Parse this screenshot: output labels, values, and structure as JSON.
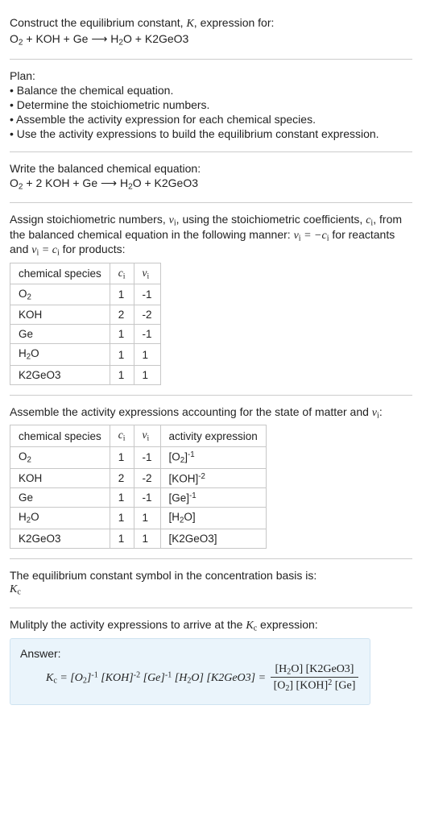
{
  "intro": {
    "line1_a": "Construct the equilibrium constant, ",
    "line1_b": ", expression for:",
    "equation": "O₂ + KOH + Ge ⟶ H₂O + K2GeO3"
  },
  "plan": {
    "heading": "Plan:",
    "items": [
      "• Balance the chemical equation.",
      "• Determine the stoichiometric numbers.",
      "• Assemble the activity expression for each chemical species.",
      "• Use the activity expressions to build the equilibrium constant expression."
    ]
  },
  "balanced": {
    "heading": "Write the balanced chemical equation:",
    "equation": "O₂ + 2 KOH + Ge ⟶ H₂O + K2GeO3"
  },
  "assign": {
    "text_a": "Assign stoichiometric numbers, ",
    "text_b": ", using the stoichiometric coefficients, ",
    "text_c": ", from the balanced chemical equation in the following manner: ",
    "text_d": " for reactants and ",
    "text_e": " for products:",
    "headers": [
      "chemical species",
      "cᵢ",
      "νᵢ"
    ],
    "rows": [
      {
        "species": "O₂",
        "c": "1",
        "v": "-1"
      },
      {
        "species": "KOH",
        "c": "2",
        "v": "-2"
      },
      {
        "species": "Ge",
        "c": "1",
        "v": "-1"
      },
      {
        "species": "H₂O",
        "c": "1",
        "v": "1"
      },
      {
        "species": "K2GeO3",
        "c": "1",
        "v": "1"
      }
    ]
  },
  "activity": {
    "heading_a": "Assemble the activity expressions accounting for the state of matter and ",
    "heading_b": ":",
    "headers": [
      "chemical species",
      "cᵢ",
      "νᵢ",
      "activity expression"
    ],
    "rows": [
      {
        "species": "O₂",
        "c": "1",
        "v": "-1",
        "expr": "[O₂]⁻¹"
      },
      {
        "species": "KOH",
        "c": "2",
        "v": "-2",
        "expr": "[KOH]⁻²"
      },
      {
        "species": "Ge",
        "c": "1",
        "v": "-1",
        "expr": "[Ge]⁻¹"
      },
      {
        "species": "H₂O",
        "c": "1",
        "v": "1",
        "expr": "[H₂O]"
      },
      {
        "species": "K2GeO3",
        "c": "1",
        "v": "1",
        "expr": "[K2GeO3]"
      }
    ]
  },
  "symbol": {
    "line1": "The equilibrium constant symbol in the concentration basis is:",
    "sym": "K꜀"
  },
  "multiply": {
    "heading_a": "Mulitply the activity expressions to arrive at the ",
    "heading_b": " expression:"
  },
  "answer": {
    "label": "Answer:",
    "lhs": "K꜀ = [O₂]⁻¹ [KOH]⁻² [Ge]⁻¹ [H₂O] [K2GeO3] = ",
    "num": "[H₂O] [K2GeO3]",
    "den": "[O₂] [KOH]² [Ge]"
  }
}
